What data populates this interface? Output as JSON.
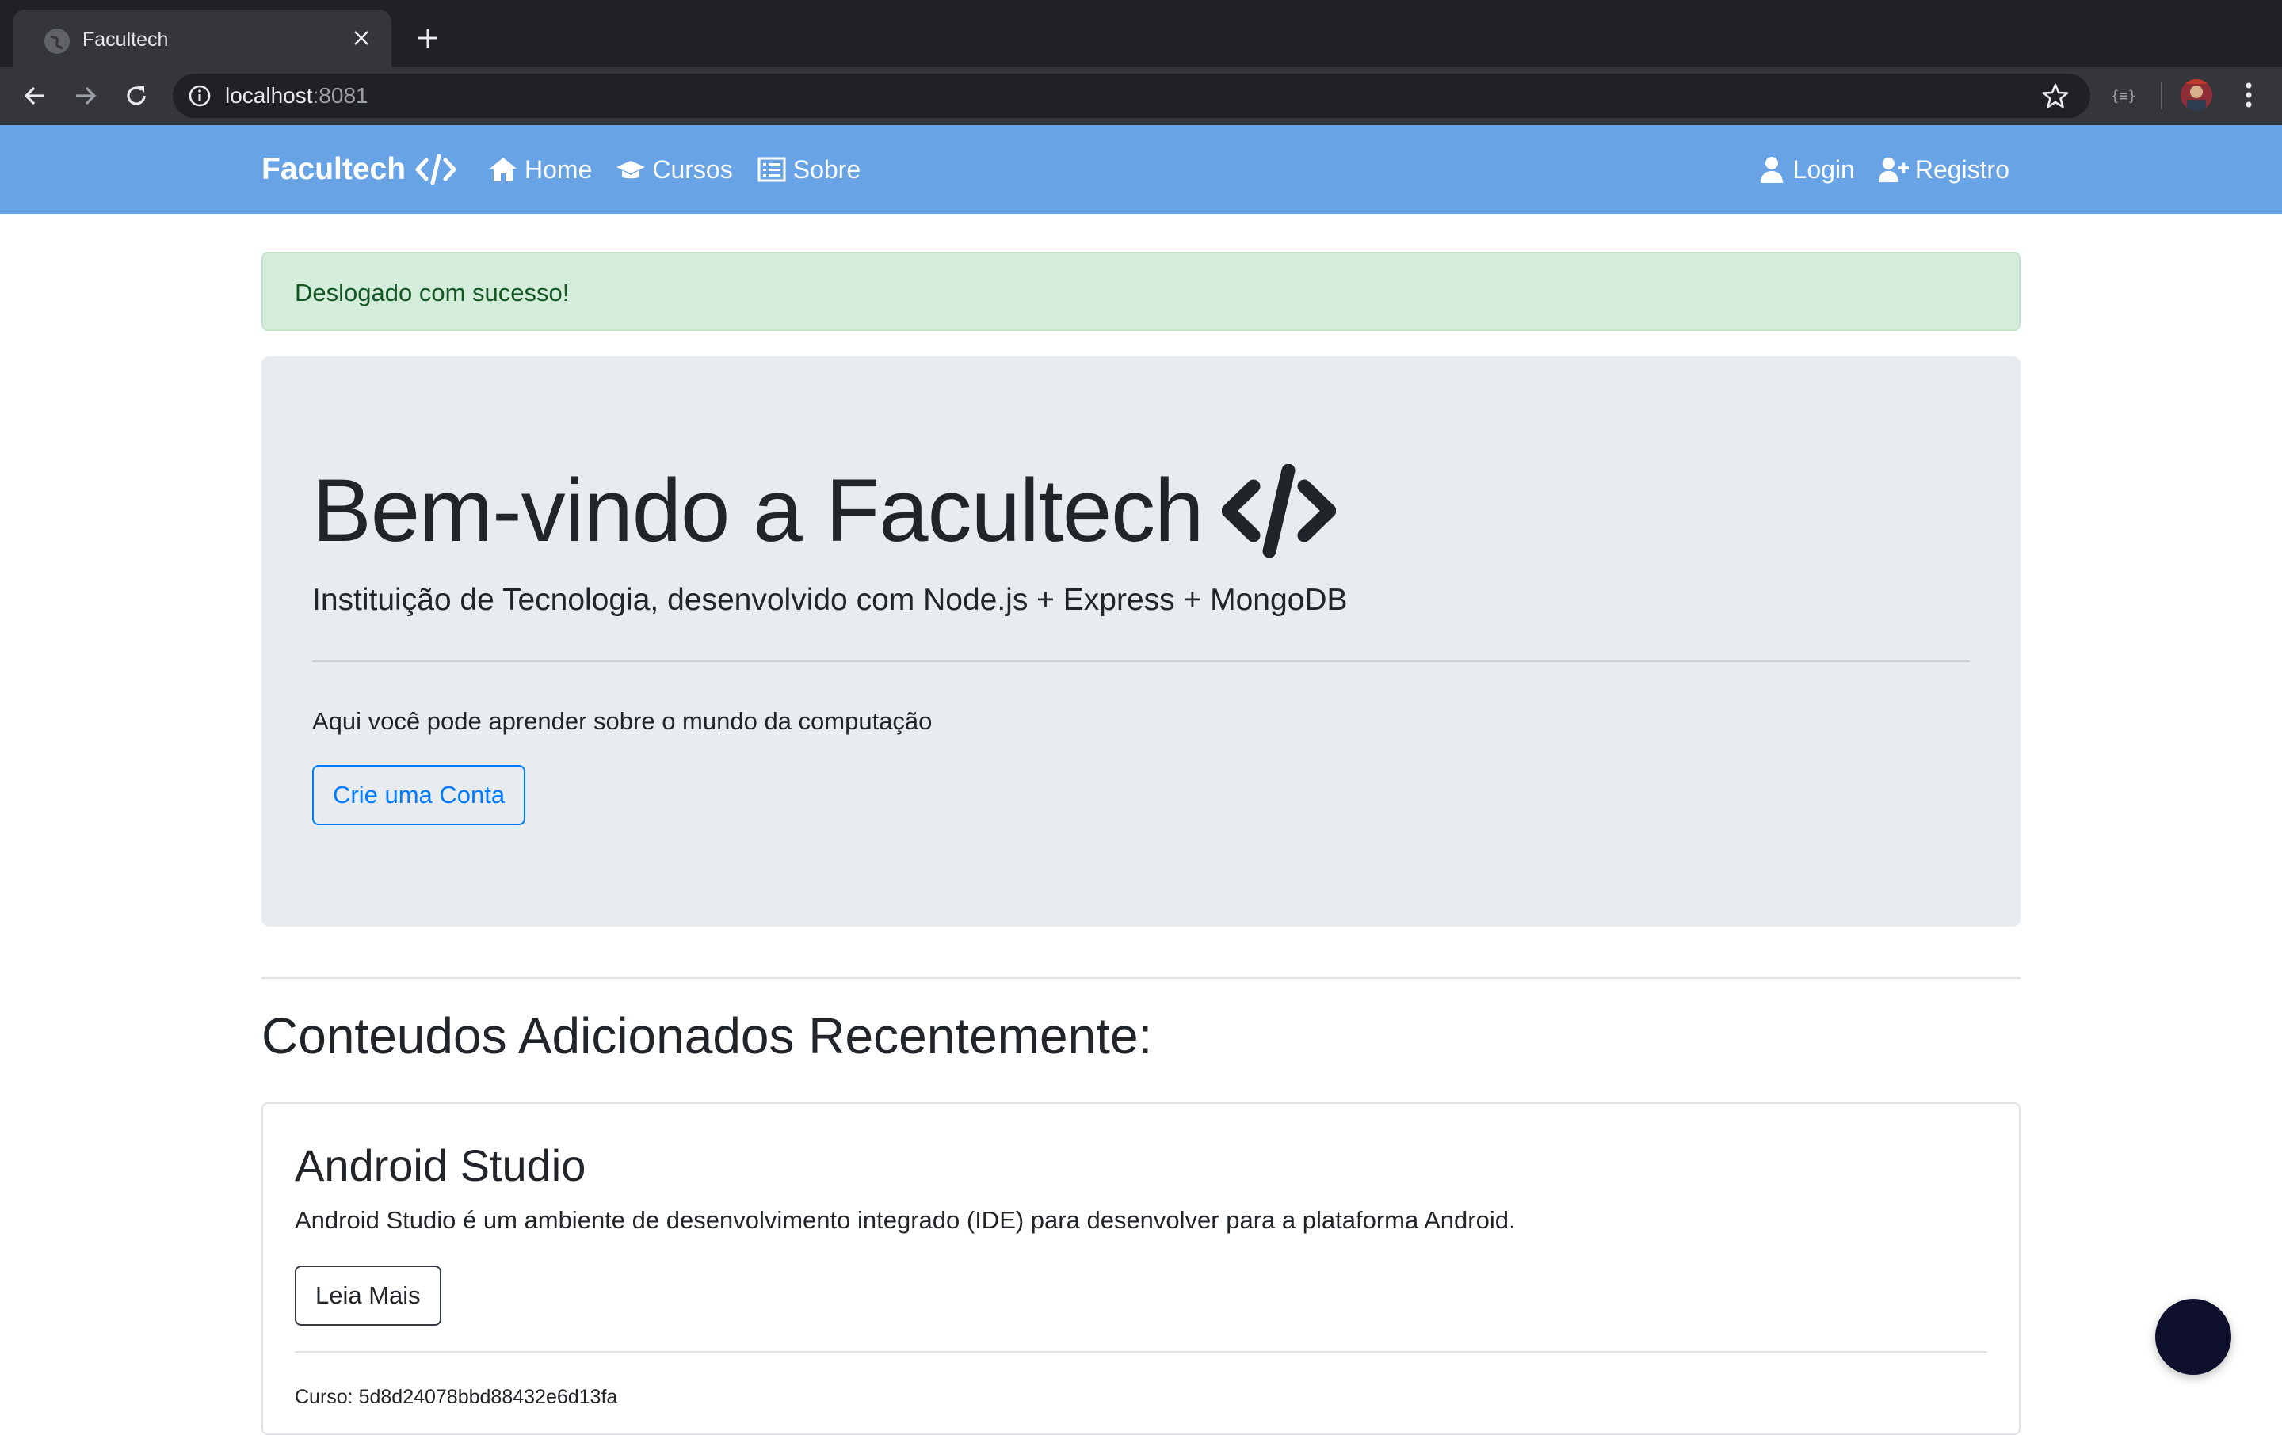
{
  "browser": {
    "tab_title": "Facultech",
    "url_host": "localhost",
    "url_port": ":8081",
    "extension_label": "{≡}"
  },
  "navbar": {
    "brand": "Facultech",
    "links": [
      {
        "label": "Home",
        "icon": "home-icon"
      },
      {
        "label": "Cursos",
        "icon": "graduation-cap-icon"
      },
      {
        "label": "Sobre",
        "icon": "list-icon"
      }
    ],
    "right_links": [
      {
        "label": "Login",
        "icon": "user-icon"
      },
      {
        "label": "Registro",
        "icon": "user-plus-icon"
      }
    ],
    "color": "#68a3e6"
  },
  "alert": {
    "message": "Deslogado com sucesso!"
  },
  "jumbotron": {
    "title": "Bem-vindo a Facultech",
    "lead": "Instituição de Tecnologia, desenvolvido com Node.js + Express + MongoDB",
    "text": "Aqui você pode aprender sobre o mundo da computação",
    "button_label": "Crie uma Conta"
  },
  "recent": {
    "title": "Conteudos Adicionados Recentemente:",
    "cards": [
      {
        "title": "Android Studio",
        "text": "Android Studio é um ambiente de desenvolvimento integrado (IDE) para desenvolver para a plataforma Android.",
        "button_label": "Leia Mais",
        "footer": "Curso: 5d8d24078bbd88432e6d13fa"
      }
    ]
  }
}
